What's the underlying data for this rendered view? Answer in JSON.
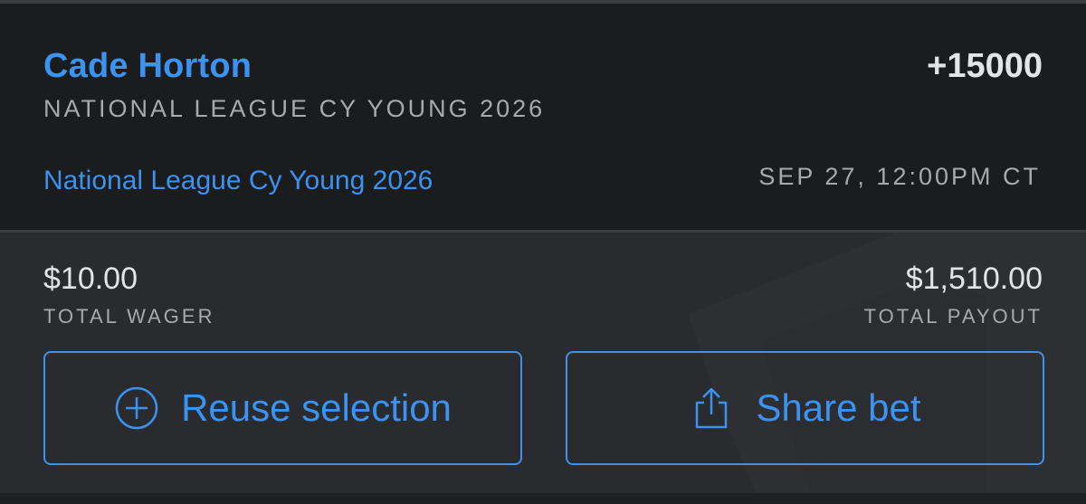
{
  "bet": {
    "selection": "Cade Horton",
    "odds": "+15000",
    "market": "NATIONAL LEAGUE CY YOUNG 2026",
    "event_link": "National League Cy Young 2026",
    "event_time": "SEP 27, 12:00PM CT"
  },
  "summary": {
    "wager_amount": "$10.00",
    "wager_label": "TOTAL WAGER",
    "payout_amount": "$1,510.00",
    "payout_label": "TOTAL PAYOUT"
  },
  "actions": {
    "reuse_label": "Reuse selection",
    "reuse_icon": "plus-circle-icon",
    "share_label": "Share bet",
    "share_icon": "share-icon"
  },
  "colors": {
    "accent": "#3b92ef",
    "header_bg": "#1b1c1e",
    "footer_bg": "#2a2b2e",
    "primary_text": "#e3e4e6",
    "secondary_text": "#a7a9ac"
  }
}
